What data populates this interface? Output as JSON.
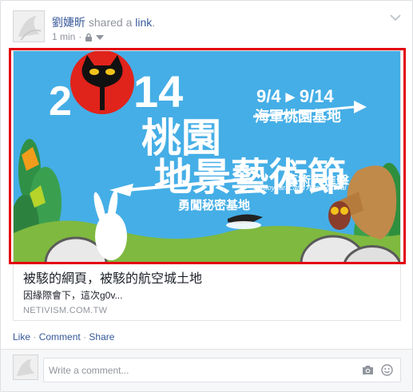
{
  "post": {
    "author": "劉婕昕",
    "action_text": "shared a",
    "link_word": "link",
    "period": ".",
    "time": "1 min",
    "separator": "·",
    "privacy_icon": "lock-icon",
    "menu_icon": "chevron-down-icon"
  },
  "attachment": {
    "banner": {
      "year_prefix": "2",
      "year_suffix": "14",
      "title_line1": "桃園",
      "title_line2": "地景藝術節",
      "dates": "9/4 ▸ 9/14",
      "venue": "海軍桃園基地",
      "english_name": "Taoyuan Land Arts Festival",
      "slogan_left": "勇闖秘密基地",
      "slogan_right": "藝術大進擊"
    },
    "title": "被駭的網頁，被駭的航空城土地",
    "description": "因緣際會下，這次g0v...",
    "domain": "NETIVISM.COM.TW"
  },
  "actions": {
    "like": "Like",
    "dot1": "·",
    "comment": "Comment",
    "dot2": "·",
    "share": "Share"
  },
  "comment_box": {
    "placeholder": "Write a comment...",
    "camera_icon": "camera-icon",
    "emoji_icon": "smile-icon"
  },
  "colors": {
    "link_blue": "#365899",
    "meta_gray": "#90949c",
    "highlight_red": "#e3000f",
    "banner_sky": "#45aee6"
  }
}
